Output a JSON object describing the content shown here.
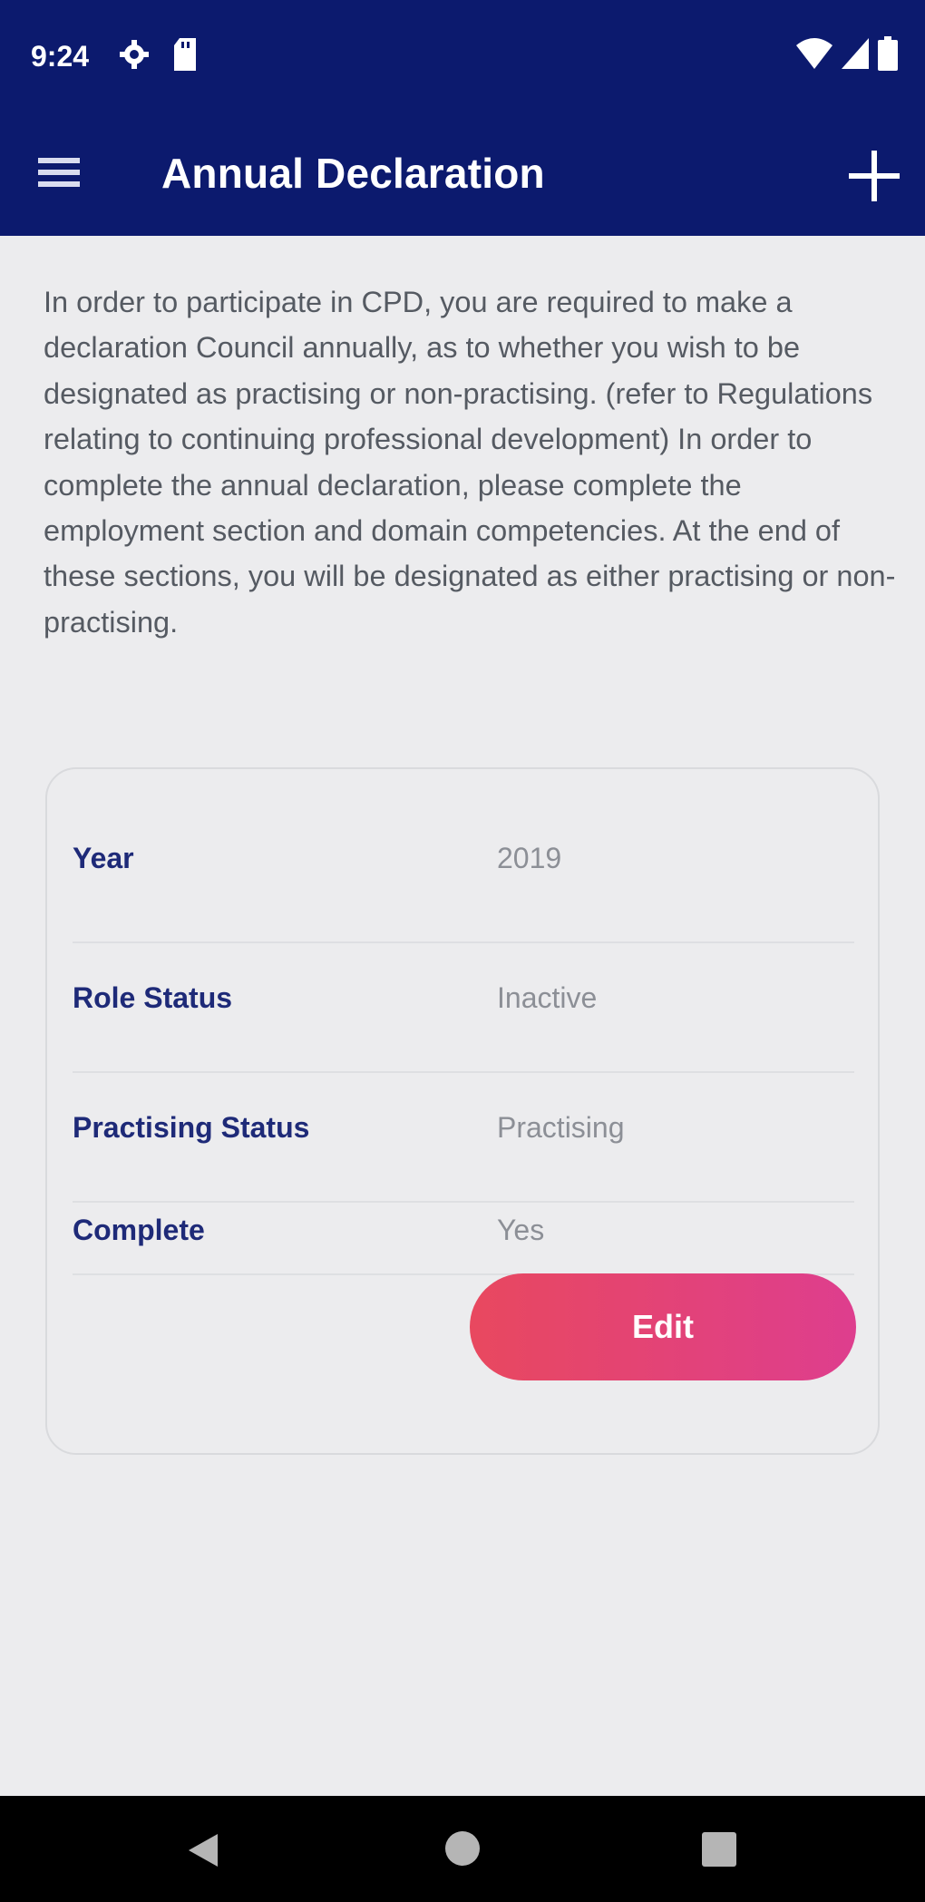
{
  "status_bar": {
    "time": "9:24",
    "icons": [
      "gear-icon",
      "sd-card-icon",
      "wifi-icon",
      "signal-icon",
      "battery-icon"
    ]
  },
  "app_bar": {
    "title": "Annual Declaration",
    "menu_icon": "menu-icon",
    "add_icon": "add-icon",
    "background_color": "#0c1a6e"
  },
  "intro_text": "In order to participate in CPD, you are required to make a declaration Council annually, as to whether you wish to be designated as practising or non-practising. (refer to Regulations relating to continuing professional development) In order to complete the annual declaration, please complete the employment section and domain competencies. At the end of these sections, you will be designated as either practising or non-practising.",
  "declaration": {
    "rows": [
      {
        "label": "Year",
        "value": "2019"
      },
      {
        "label": "Role Status",
        "value": "Inactive"
      },
      {
        "label": "Practising Status",
        "value": "Practising"
      },
      {
        "label": "Complete",
        "value": "Yes"
      }
    ],
    "edit_label": "Edit"
  },
  "nav_bar": {
    "icons": [
      "back-icon",
      "home-icon",
      "recents-icon"
    ]
  }
}
